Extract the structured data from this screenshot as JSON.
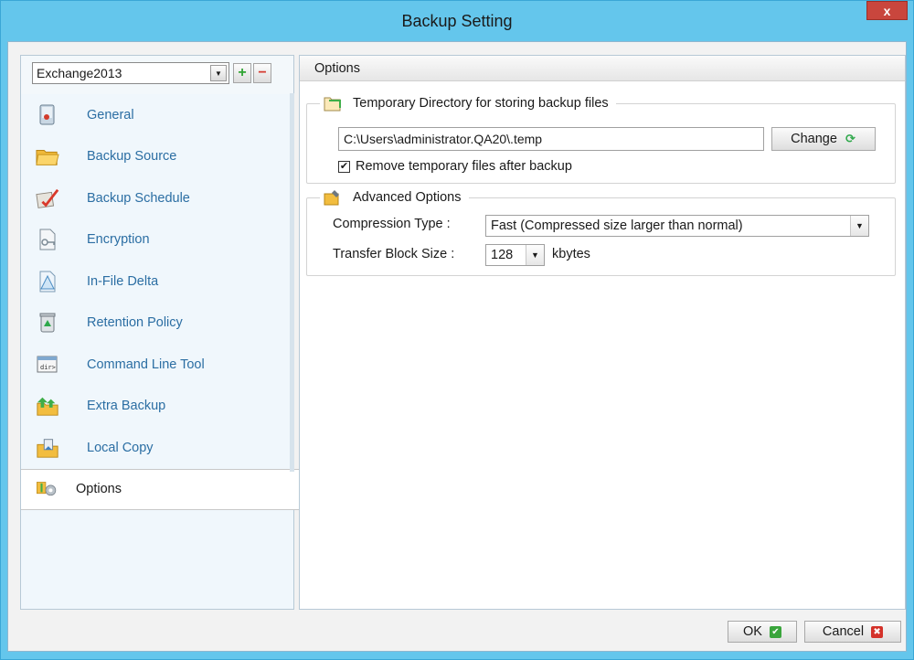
{
  "window": {
    "title": "Backup Setting",
    "close_label": "x"
  },
  "left": {
    "backup_set": "Exchange2013",
    "add_label": "+",
    "remove_label": "−",
    "nav": [
      {
        "label": "General",
        "icon": "general-icon"
      },
      {
        "label": "Backup Source",
        "icon": "folder-icon"
      },
      {
        "label": "Backup Schedule",
        "icon": "schedule-icon"
      },
      {
        "label": "Encryption",
        "icon": "encryption-icon"
      },
      {
        "label": "In-File Delta",
        "icon": "delta-icon"
      },
      {
        "label": "Retention Policy",
        "icon": "recycle-bin-icon"
      },
      {
        "label": "Command Line Tool",
        "icon": "command-line-icon"
      },
      {
        "label": "Extra Backup",
        "icon": "extra-backup-icon"
      },
      {
        "label": "Local Copy",
        "icon": "local-copy-icon"
      },
      {
        "label": "Options",
        "icon": "options-gear-icon",
        "active": true
      }
    ]
  },
  "right": {
    "header": "Options",
    "temp_dir": {
      "legend": "Temporary Directory for storing backup files",
      "path": "C:\\Users\\administrator.QA20\\.temp",
      "change_label": "Change",
      "remove_checkbox_label": "Remove temporary files after backup",
      "remove_checked": true
    },
    "advanced": {
      "legend": "Advanced Options",
      "compression_label": "Compression Type :",
      "compression_value": "Fast (Compressed size larger than normal)",
      "block_label": "Transfer Block Size :",
      "block_value": "128",
      "block_unit": "kbytes"
    }
  },
  "footer": {
    "ok_label": "OK",
    "cancel_label": "Cancel"
  },
  "colors": {
    "title_bar": "#64c6ec",
    "nav_text": "#2b6ea3",
    "close": "#c9463d",
    "ok_badge": "#3aa53c",
    "cancel_badge": "#d4322a"
  }
}
